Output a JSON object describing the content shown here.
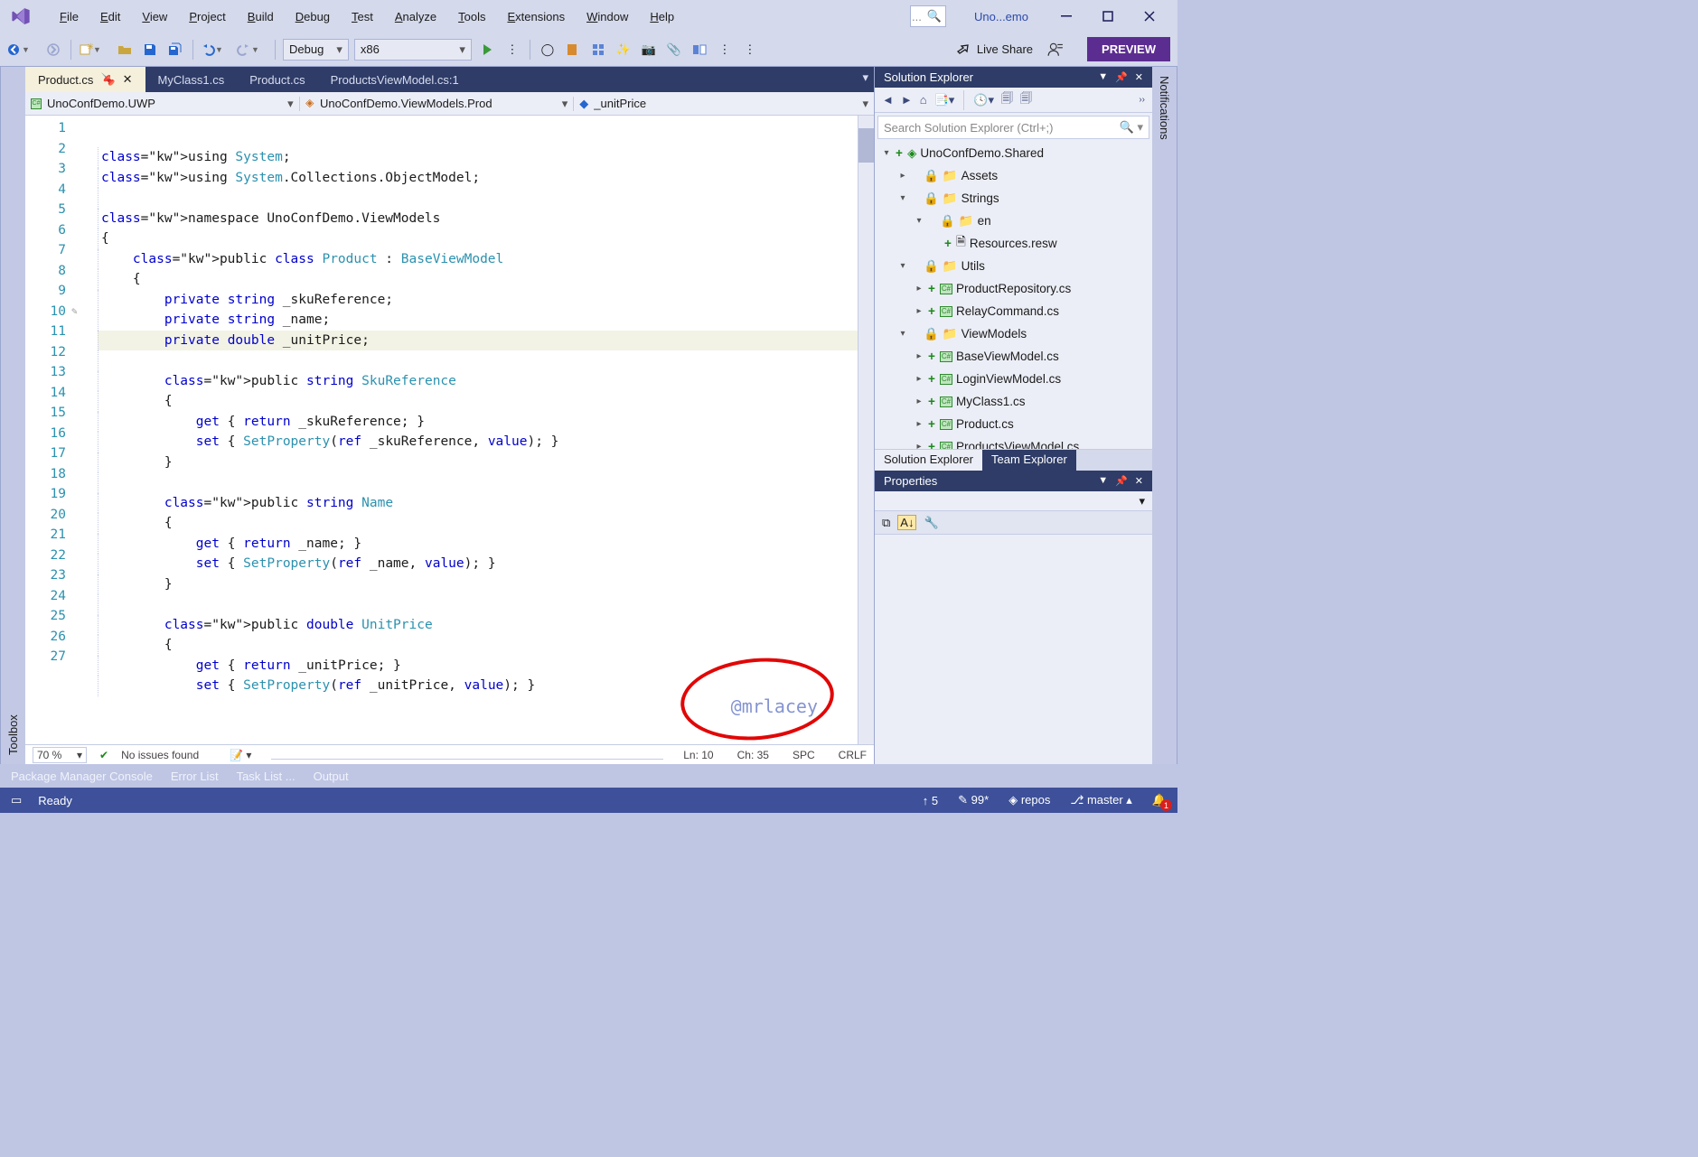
{
  "window": {
    "title": "Uno...emo"
  },
  "menu": {
    "items": [
      "File",
      "Edit",
      "View",
      "Project",
      "Build",
      "Debug",
      "Test",
      "Analyze",
      "Tools",
      "Extensions",
      "Window",
      "Help"
    ]
  },
  "toolbar": {
    "config": "Debug",
    "platform": "x86",
    "live_share": "Live Share",
    "preview": "PREVIEW"
  },
  "sidebars": {
    "left": "Toolbox",
    "right": "Notifications"
  },
  "tabs": {
    "items": [
      {
        "label": "Product.cs",
        "active": true,
        "pinned": true,
        "closable": true
      },
      {
        "label": "MyClass1.cs"
      },
      {
        "label": "Product.cs"
      },
      {
        "label": "ProductsViewModel.cs:1"
      }
    ]
  },
  "navbar": {
    "project": "UnoConfDemo.UWP",
    "class": "UnoConfDemo.ViewModels.Prod",
    "member": "_unitPrice"
  },
  "code": {
    "lines": [
      "using System;",
      "using System.Collections.ObjectModel;",
      "",
      "namespace UnoConfDemo.ViewModels",
      "{",
      "    public class Product : BaseViewModel",
      "    {",
      "        private string _skuReference;",
      "        private string _name;",
      "        private double _unitPrice;",
      "",
      "        public string SkuReference",
      "        {",
      "            get { return _skuReference; }",
      "            set { SetProperty(ref _skuReference, value); }",
      "        }",
      "",
      "        public string Name",
      "        {",
      "            get { return _name; }",
      "            set { SetProperty(ref _name, value); }",
      "        }",
      "",
      "        public double UnitPrice",
      "        {",
      "            get { return _unitPrice; }",
      "            set { SetProperty(ref _unitPrice, value); }"
    ],
    "watermark": "@mrlacey"
  },
  "editorstatus": {
    "zoom": "70 %",
    "issues": "No issues found",
    "line": "Ln: 10",
    "ch": "Ch: 35",
    "spc": "SPC",
    "eol": "CRLF"
  },
  "solution_explorer": {
    "title": "Solution Explorer",
    "search_placeholder": "Search Solution Explorer (Ctrl+;)",
    "tree": [
      {
        "indent": 0,
        "tw": "▾",
        "plus": "+",
        "icon": "◈",
        "label": "UnoConfDemo.Shared"
      },
      {
        "indent": 1,
        "tw": "▸",
        "plus": "",
        "icon": "folder",
        "label": "Assets",
        "locked": true
      },
      {
        "indent": 1,
        "tw": "▾",
        "plus": "",
        "icon": "folder",
        "label": "Strings",
        "locked": true
      },
      {
        "indent": 2,
        "tw": "▾",
        "plus": "",
        "icon": "folder",
        "label": "en",
        "locked": true
      },
      {
        "indent": 3,
        "tw": "",
        "plus": "+",
        "icon": "file",
        "label": "Resources.resw"
      },
      {
        "indent": 1,
        "tw": "▾",
        "plus": "",
        "icon": "folder",
        "label": "Utils",
        "locked": true
      },
      {
        "indent": 2,
        "tw": "▸",
        "plus": "+",
        "icon": "cs",
        "label": "ProductRepository.cs"
      },
      {
        "indent": 2,
        "tw": "▸",
        "plus": "+",
        "icon": "cs",
        "label": "RelayCommand.cs"
      },
      {
        "indent": 1,
        "tw": "▾",
        "plus": "",
        "icon": "folder",
        "label": "ViewModels",
        "locked": true
      },
      {
        "indent": 2,
        "tw": "▸",
        "plus": "+",
        "icon": "cs",
        "label": "BaseViewModel.cs"
      },
      {
        "indent": 2,
        "tw": "▸",
        "plus": "+",
        "icon": "cs",
        "label": "LoginViewModel.cs"
      },
      {
        "indent": 2,
        "tw": "▸",
        "plus": "+",
        "icon": "cs",
        "label": "MyClass1.cs"
      },
      {
        "indent": 2,
        "tw": "▸",
        "plus": "+",
        "icon": "cs",
        "label": "Product.cs"
      },
      {
        "indent": 2,
        "tw": "▸",
        "plus": "+",
        "icon": "cs",
        "label": "ProductsViewModel.cs"
      }
    ],
    "tab_active": "Solution Explorer",
    "tab_other": "Team Explorer"
  },
  "properties": {
    "title": "Properties"
  },
  "bottom_tabs": [
    "Package Manager Console",
    "Error List",
    "Task List ...",
    "Output"
  ],
  "statusbar": {
    "status": "Ready",
    "outgoing": "5",
    "changes": "99*",
    "repo": "repos",
    "branch": "master",
    "notify_count": "1"
  }
}
